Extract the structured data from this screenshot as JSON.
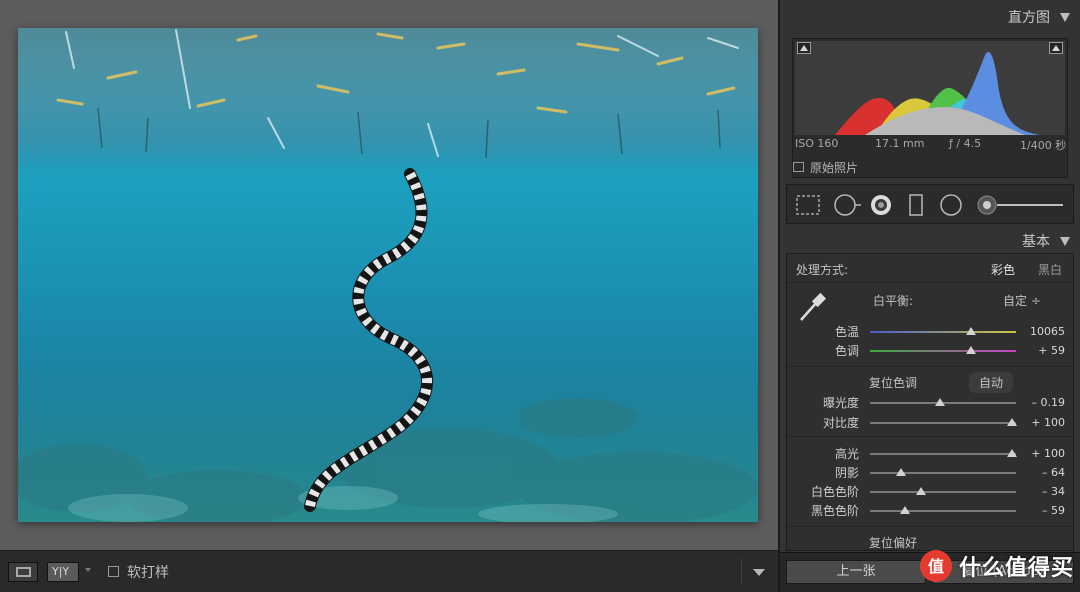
{
  "panel": {
    "histogram_title": "直方图",
    "exif": {
      "iso": "ISO 160",
      "focal": "17.1 mm",
      "aperture": "ƒ / 4.5",
      "shutter": "1/400 秒"
    },
    "original_photo_label": "原始照片",
    "basic_title": "基本",
    "treatment_label": "处理方式:",
    "treatment_color": "彩色",
    "treatment_bw": "黑白",
    "wb_label": "白平衡:",
    "wb_value": "自定 ÷",
    "tone_reset": "复位色调",
    "tone_auto": "自动",
    "presence_reset": "复位偏好",
    "sliders": {
      "temp": {
        "label": "色温",
        "value": "10065",
        "level": 0.69
      },
      "tint": {
        "label": "色调",
        "value": "+ 59",
        "level": 0.69
      },
      "exposure": {
        "label": "曝光度",
        "value": "– 0.19",
        "level": 0.48
      },
      "contrast": {
        "label": "对比度",
        "value": "+ 100",
        "level": 0.97
      },
      "highlights": {
        "label": "高光",
        "value": "+ 100",
        "level": 0.97
      },
      "shadows": {
        "label": "阴影",
        "value": "– 64",
        "level": 0.21
      },
      "whites": {
        "label": "白色色阶",
        "value": "– 34",
        "level": 0.35
      },
      "blacks": {
        "label": "黑色色阶",
        "value": "– 59",
        "level": 0.24
      }
    },
    "prev_button": "上一张",
    "reset_button": "复位 (Adobe)"
  },
  "toolbar": {
    "compare_label": "Y|Y",
    "softproof_label": "软打样"
  },
  "watermark": {
    "text": "什么值得买",
    "logo_glyph": "值"
  },
  "colors": {
    "accent": "#c8c8c8",
    "panel_bg": "#333333",
    "viewer_bg": "#5c5c5c",
    "watermark_red": "#e53a2f"
  }
}
